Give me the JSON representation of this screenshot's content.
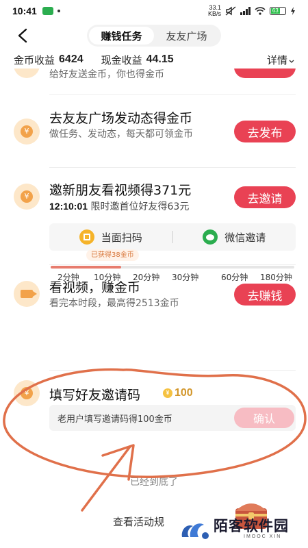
{
  "status_bar": {
    "time": "10:41",
    "net_speed_value": "33.1",
    "net_speed_unit": "KB/s",
    "battery": "63"
  },
  "header": {
    "tabs": [
      {
        "label": "赚钱任务",
        "active": true
      },
      {
        "label": "友友广场",
        "active": false
      }
    ]
  },
  "summary": {
    "coin_label": "金币收益",
    "coin_value": "6424",
    "cash_label": "现金收益",
    "cash_value": "44.15",
    "details_label": "详情"
  },
  "tasks": {
    "partial": {
      "subtitle": "给好友送金币，你也得金币"
    },
    "post": {
      "title": "去友友广场发动态得金币",
      "subtitle": "做任务、发动态，每天都可领金币",
      "button": "去发布",
      "icon_symbol": "¥"
    },
    "invite": {
      "title": "邀新朋友看视频得371元",
      "countdown": "12:10:01",
      "subtitle": "限时邀首位好友得63元",
      "button": "去邀请",
      "icon_symbol": "¥",
      "scan_label": "当面扫码",
      "wechat_label": "微信邀请"
    },
    "watch": {
      "title": "看视频，赚金币",
      "subtitle": "看完本时段，最高得2513金币",
      "button": "去赚钱",
      "earned_tag": "已获得38金币",
      "progress": 0.29,
      "ticks": [
        "2分钟",
        "10分钟",
        "20分钟",
        "30分钟",
        "60分钟",
        "180分钟"
      ]
    },
    "code": {
      "title": "填写好友邀请码",
      "reward": "100",
      "icon_symbol": "¥",
      "placeholder": "老用户填写邀请码得100金币",
      "button": "确认"
    }
  },
  "footer": {
    "end_note": "已经到底了",
    "rules_link": "查看活动规"
  },
  "watermark": {
    "text": "陌客软件园",
    "sub": "IMOOC XIN"
  },
  "colors": {
    "accent_red": "#e94254",
    "coin_orange": "#f2a24a",
    "annotation": "#e0704a"
  }
}
